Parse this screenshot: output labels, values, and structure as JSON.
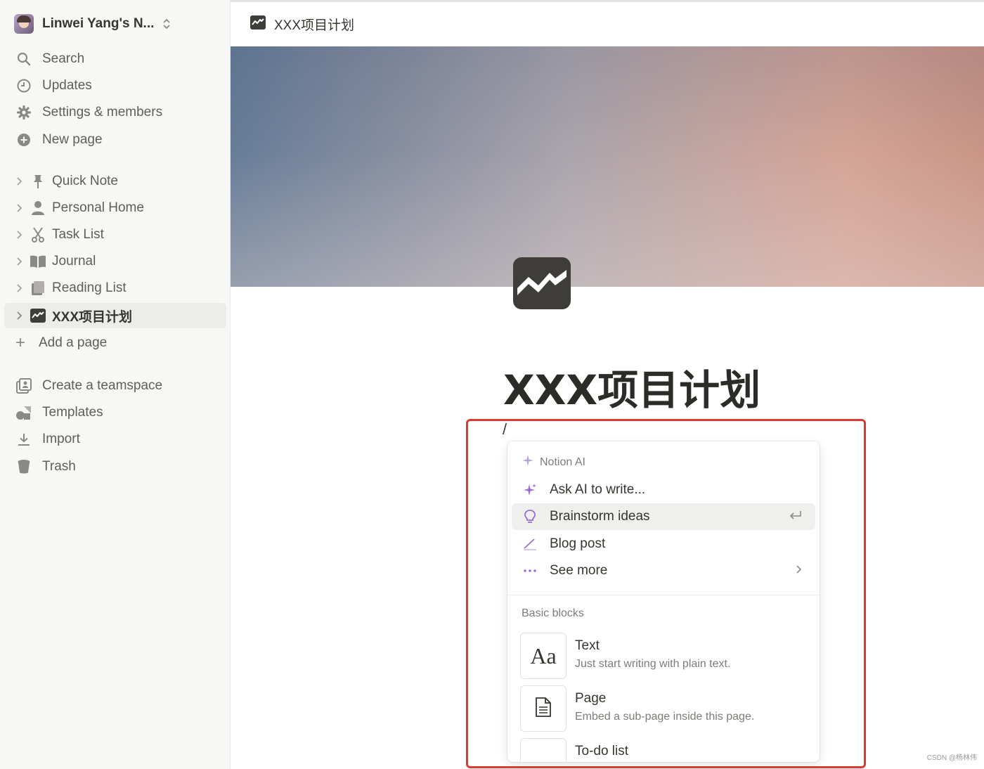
{
  "workspace": {
    "name": "Linwei Yang's N..."
  },
  "nav": [
    {
      "label": "Search",
      "icon": "search-icon"
    },
    {
      "label": "Updates",
      "icon": "clock-icon"
    },
    {
      "label": "Settings & members",
      "icon": "gear-icon"
    },
    {
      "label": "New page",
      "icon": "plus-circle-icon"
    }
  ],
  "pages": [
    {
      "label": "Quick Note",
      "icon": "pin-icon"
    },
    {
      "label": "Personal Home",
      "icon": "person-icon"
    },
    {
      "label": "Task List",
      "icon": "scissors-icon"
    },
    {
      "label": "Journal",
      "icon": "book-icon"
    },
    {
      "label": "Reading List",
      "icon": "books-icon"
    },
    {
      "label": "XXX项目计划",
      "icon": "chart-icon",
      "active": true
    }
  ],
  "add_page": "Add a page",
  "footer_nav": [
    {
      "label": "Create a teamspace",
      "icon": "teamspace-icon"
    },
    {
      "label": "Templates",
      "icon": "shapes-icon"
    },
    {
      "label": "Import",
      "icon": "download-icon"
    },
    {
      "label": "Trash",
      "icon": "trash-icon"
    }
  ],
  "breadcrumb": {
    "title": "XXX项目计划"
  },
  "page": {
    "title": "XXX项目计划",
    "slash": "/"
  },
  "menu": {
    "ai_section": "Notion AI",
    "ai_items": [
      {
        "label": "Ask AI to write...",
        "icon": "sparkle-icon"
      },
      {
        "label": "Brainstorm ideas",
        "icon": "lightbulb-icon",
        "hint": "↵"
      },
      {
        "label": "Blog post",
        "icon": "pen-icon"
      },
      {
        "label": "See more",
        "icon": "more-icon",
        "hint": "›"
      }
    ],
    "basic_section": "Basic blocks",
    "blocks": [
      {
        "title": "Text",
        "desc": "Just start writing with plain text.",
        "thumb": "Aa"
      },
      {
        "title": "Page",
        "desc": "Embed a sub-page inside this page."
      },
      {
        "title": "To-do list",
        "desc": ""
      }
    ]
  },
  "watermark": "CSDN @杨林伟",
  "colors": {
    "highlight": "#d93a31",
    "sidebar_bg": "#f7f7f5",
    "ai_purple": "#9a6dd7"
  }
}
